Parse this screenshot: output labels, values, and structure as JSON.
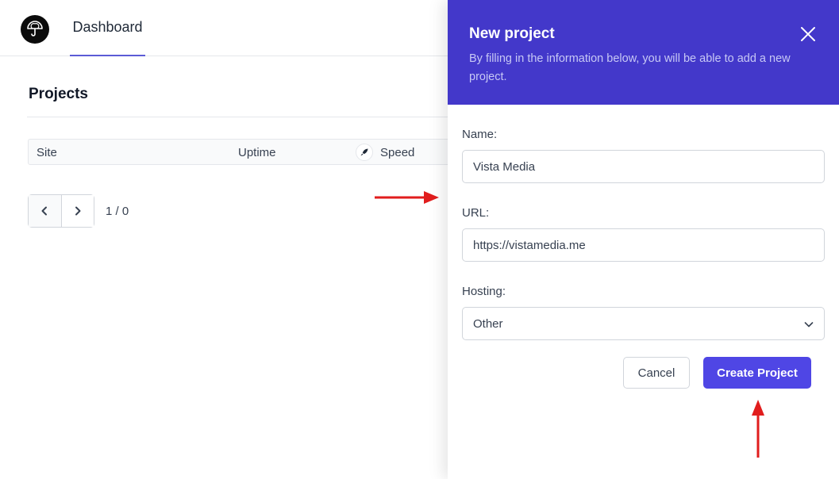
{
  "nav": {
    "logo_icon": "umbrella-icon",
    "active_tab": "Dashboard"
  },
  "projects": {
    "title": "Projects",
    "columns": [
      "Site",
      "Uptime",
      "Speed"
    ],
    "speed_icon": "rocket-icon",
    "pagination": {
      "prev_icon": "chevron-left-icon",
      "next_icon": "chevron-right-icon",
      "info": "1 / 0"
    }
  },
  "modal": {
    "title": "New project",
    "description": "By filling in the information below, you will be able to add a new project.",
    "close_icon": "close-icon",
    "fields": {
      "name": {
        "label": "Name:",
        "value": "Vista Media"
      },
      "url": {
        "label": "URL:",
        "value": "https://vistamedia.me"
      },
      "hosting": {
        "label": "Hosting:",
        "value": "Other"
      }
    },
    "cancel_label": "Cancel",
    "create_label": "Create Project"
  },
  "colors": {
    "header_bg": "#4338ca",
    "primary_button": "#4f46e5",
    "tab_underline": "#5b5bd6",
    "annotation_arrow": "#e11d1d"
  }
}
